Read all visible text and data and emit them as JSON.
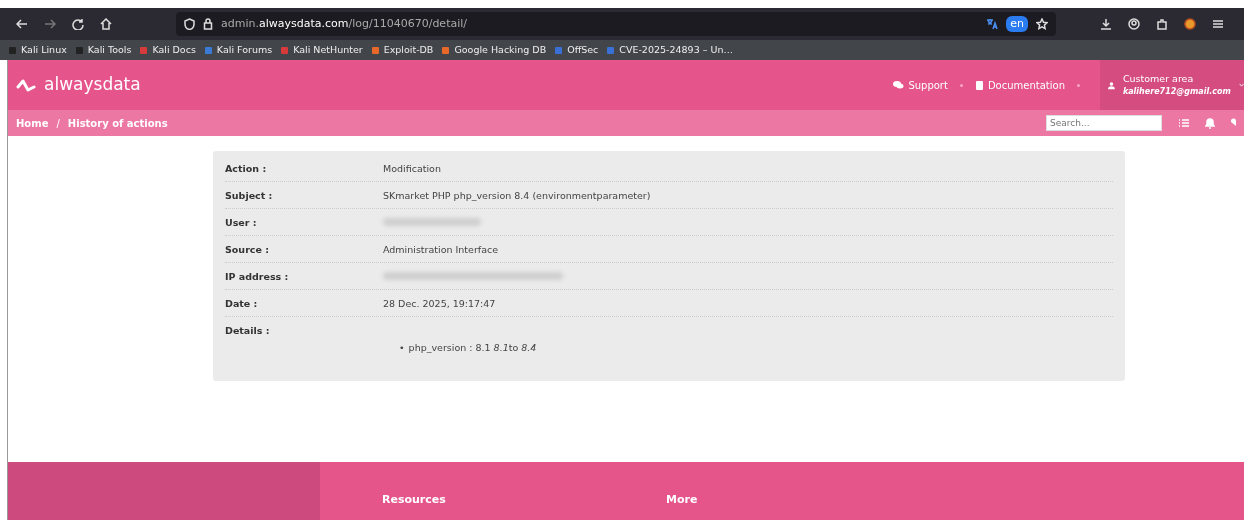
{
  "browser": {
    "url_host_prefix": "admin.",
    "url_host": "alwaysdata.com",
    "url_path": "/log/11040670/detail/",
    "translate_badge": "en",
    "bookmarks": [
      {
        "label": "Kali Linux",
        "color": "#222222"
      },
      {
        "label": "Kali Tools",
        "color": "#222222"
      },
      {
        "label": "Kali Docs",
        "color": "#d63a3a"
      },
      {
        "label": "Kali Forums",
        "color": "#3a7bd5"
      },
      {
        "label": "Kali NetHunter",
        "color": "#d63a3a"
      },
      {
        "label": "Exploit-DB",
        "color": "#e8682a"
      },
      {
        "label": "Google Hacking DB",
        "color": "#e8682a"
      },
      {
        "label": "OffSec",
        "color": "#3a6fd5"
      },
      {
        "label": "CVE-2025-24893 – Un…",
        "color": "#3a6fd5"
      }
    ]
  },
  "header": {
    "logo": "alwaysdata",
    "links": [
      "Support",
      "Documentation"
    ],
    "account": {
      "title": "Customer area",
      "email": "kalihere712@gmail.com"
    }
  },
  "breadcrumb": {
    "separator": "/",
    "items": [
      "Home",
      "History of actions"
    ]
  },
  "search": {
    "placeholder": "Search..."
  },
  "details": [
    {
      "label": "Action :",
      "value": "Modification"
    },
    {
      "label": "Subject :",
      "value": "SKmarket PHP php_version 8.4 (environmentparameter)"
    },
    {
      "label": "User :",
      "redacted": true
    },
    {
      "label": "Source :",
      "value": "Administration Interface"
    },
    {
      "label": "IP address :",
      "redacted": true
    },
    {
      "label": "Date :",
      "value": "28 Dec. 2025, 19:17:47"
    },
    {
      "label": "Details :",
      "items": [
        {
          "bullet": "•",
          "parts": [
            {
              "text": "php_version : 8.1 ",
              "italic": false
            },
            {
              "text": "8.1",
              "italic": true
            },
            {
              "text": "to ",
              "italic": false
            },
            {
              "text": "8.4",
              "italic": true
            }
          ]
        }
      ]
    }
  ],
  "footer": {
    "columns": [
      "Resources",
      "More"
    ]
  }
}
